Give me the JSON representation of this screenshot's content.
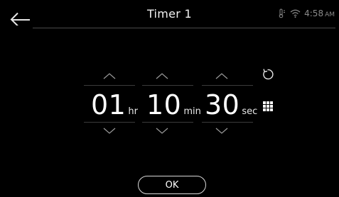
{
  "header": {
    "title": "Timer 1",
    "status_time": "4:58",
    "status_ampm": "AM",
    "status_icons": [
      "thermometer-icon",
      "wifi-icon"
    ]
  },
  "timer": {
    "hours": {
      "value": "01",
      "unit": "hr"
    },
    "minutes": {
      "value": "10",
      "unit": "min"
    },
    "seconds": {
      "value": "30",
      "unit": "sec"
    }
  },
  "actions": {
    "ok_label": "OK",
    "icons": [
      "back-arrow-icon",
      "chevron-up-icon",
      "chevron-down-icon",
      "reset-icon",
      "keypad-icon"
    ]
  },
  "colors": {
    "background": "#000000",
    "text": "#ffffff",
    "divider": "#3c3c3c",
    "status_text": "#8a8a8a"
  }
}
